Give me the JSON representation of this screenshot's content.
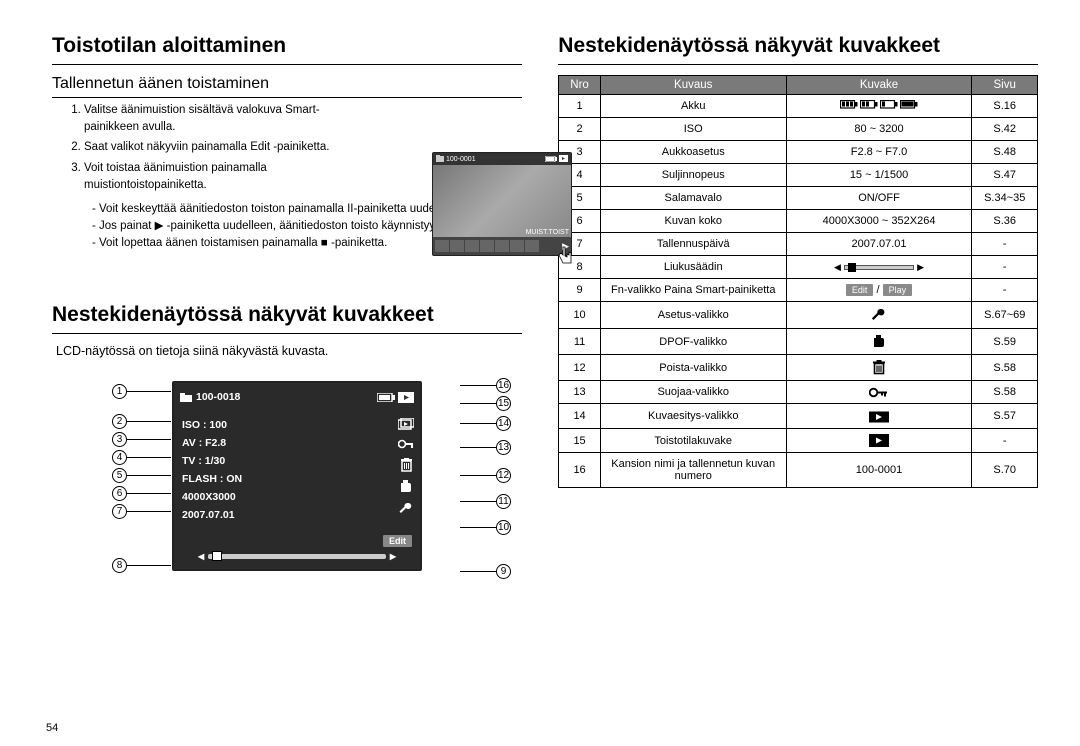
{
  "left": {
    "h1": "Toistotilan aloittaminen",
    "h2": "Tallennetun äänen toistaminen",
    "steps": [
      "Valitse äänimuistion sisältävä valokuva Smart-painikkeen avulla.",
      "Saat valikot näkyviin painamalla Edit -painiketta.",
      "Voit toistaa äänimuistion painamalla muistiontoistopainiketta."
    ],
    "notes": [
      "- Voit keskeyttää äänitiedoston toiston painamalla II-painiketta uudelleen.",
      "- Jos painat ▶ -painiketta uudelleen, äänitiedoston toisto käynnistyy uudelleen.",
      "- Voit lopettaa äänen toistamisen painamalla ■ -painiketta."
    ],
    "thumb": {
      "folder": "100-0001",
      "label": "MUIST.TOIST"
    },
    "h1b": "Nestekidenäytössä näkyvät kuvakkeet",
    "intro": "LCD-näytössä on tietoja siinä näkyvästä kuvasta.",
    "lcd": {
      "folder_no": "100-0018",
      "iso": "ISO : 100",
      "av": "AV : F2.8",
      "tv": "TV : 1/30",
      "flash": "FLASH : ON",
      "size": "4000X3000",
      "date": "2007.07.01",
      "edit": "Edit"
    },
    "labels_left": [
      "1",
      "2",
      "3",
      "4",
      "5",
      "6",
      "7",
      "8"
    ],
    "labels_right": [
      "16",
      "15",
      "14",
      "13",
      "12",
      "11",
      "10",
      "9"
    ]
  },
  "right": {
    "h1": "Nestekidenäytössä näkyvät kuvakkeet",
    "headers": [
      "Nro",
      "Kuvaus",
      "Kuvake",
      "Sivu"
    ],
    "rows": [
      {
        "nro": "1",
        "kuvaus": "Akku",
        "kuvake": "battery",
        "sivu": "S.16"
      },
      {
        "nro": "2",
        "kuvaus": "ISO",
        "kuvake_text": "80 ~ 3200",
        "sivu": "S.42"
      },
      {
        "nro": "3",
        "kuvaus": "Aukkoasetus",
        "kuvake_text": "F2.8 ~ F7.0",
        "sivu": "S.48"
      },
      {
        "nro": "4",
        "kuvaus": "Suljinnopeus",
        "kuvake_text": "15 ~ 1/1500",
        "sivu": "S.47"
      },
      {
        "nro": "5",
        "kuvaus": "Salamavalo",
        "kuvake_text": "ON/OFF",
        "sivu": "S.34~35"
      },
      {
        "nro": "6",
        "kuvaus": "Kuvan koko",
        "kuvake_text": "4000X3000 ~ 352X264",
        "sivu": "S.36"
      },
      {
        "nro": "7",
        "kuvaus": "Tallennuspäivä",
        "kuvake_text": "2007.07.01",
        "sivu": "-"
      },
      {
        "nro": "8",
        "kuvaus": "Liukusäädin",
        "kuvake": "slider",
        "sivu": "-"
      },
      {
        "nro": "9",
        "kuvaus": "Fn-valikko Paina Smart-painiketta",
        "kuvake": "editplay",
        "sivu": "-"
      },
      {
        "nro": "10",
        "kuvaus": "Asetus-valikko",
        "kuvake": "wrench",
        "sivu": "S.67~69"
      },
      {
        "nro": "11",
        "kuvaus": "DPOF-valikko",
        "kuvake": "dpof",
        "sivu": "S.59"
      },
      {
        "nro": "12",
        "kuvaus": "Poista-valikko",
        "kuvake": "trash",
        "sivu": "S.58"
      },
      {
        "nro": "13",
        "kuvaus": "Suojaa-valikko",
        "kuvake": "key",
        "sivu": "S.58"
      },
      {
        "nro": "14",
        "kuvaus": "Kuvaesitys-valikko",
        "kuvake": "slideshow",
        "sivu": "S.57"
      },
      {
        "nro": "15",
        "kuvaus": "Toistotilakuvake",
        "kuvake": "playmode",
        "sivu": "-"
      },
      {
        "nro": "16",
        "kuvaus": "Kansion nimi ja tallennetun kuvan numero",
        "kuvake_text": "100-0001",
        "sivu": "S.70"
      }
    ],
    "editplay": {
      "edit": "Edit",
      "play": "Play",
      "sep": "/"
    }
  },
  "page_number": "54"
}
